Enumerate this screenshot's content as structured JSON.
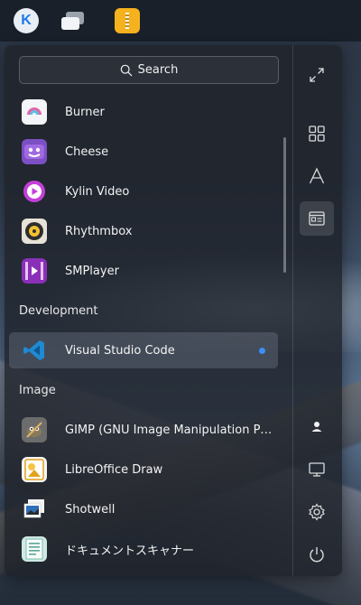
{
  "taskbar": {
    "icons": [
      "kylin-start-icon",
      "multitask-view-icon",
      "archive-manager-icon"
    ]
  },
  "search": {
    "placeholder": "Search"
  },
  "sections": [
    {
      "title": ""
    },
    {
      "title": "Development"
    },
    {
      "title": "Image"
    }
  ],
  "apps": [
    {
      "label": "Burner",
      "icon": "burner-icon"
    },
    {
      "label": "Cheese",
      "icon": "cheese-icon"
    },
    {
      "label": "Kylin Video",
      "icon": "kylin-video-icon"
    },
    {
      "label": "Rhythmbox",
      "icon": "rhythmbox-icon"
    },
    {
      "label": "SMPlayer",
      "icon": "smplayer-icon"
    },
    {
      "label": "Visual Studio Code",
      "icon": "vscode-icon",
      "active": true
    },
    {
      "label": "GIMP (GNU Image Manipulation Program)",
      "icon": "gimp-icon"
    },
    {
      "label": "LibreOffice Draw",
      "icon": "libreoffice-draw-icon"
    },
    {
      "label": "Shotwell",
      "icon": "shotwell-icon"
    },
    {
      "label": "ドキュメントスキャナー",
      "icon": "document-scanner-icon"
    }
  ],
  "sidebar": {
    "top": [
      "fullscreen-icon",
      "category-view-icon",
      "letter-sort-icon",
      "function-sort-icon"
    ],
    "bottom": [
      "user-icon",
      "computer-icon",
      "settings-icon",
      "power-icon"
    ]
  },
  "colors": {
    "accent": "#3d8ef5",
    "menu_bg": "#1e222a"
  }
}
